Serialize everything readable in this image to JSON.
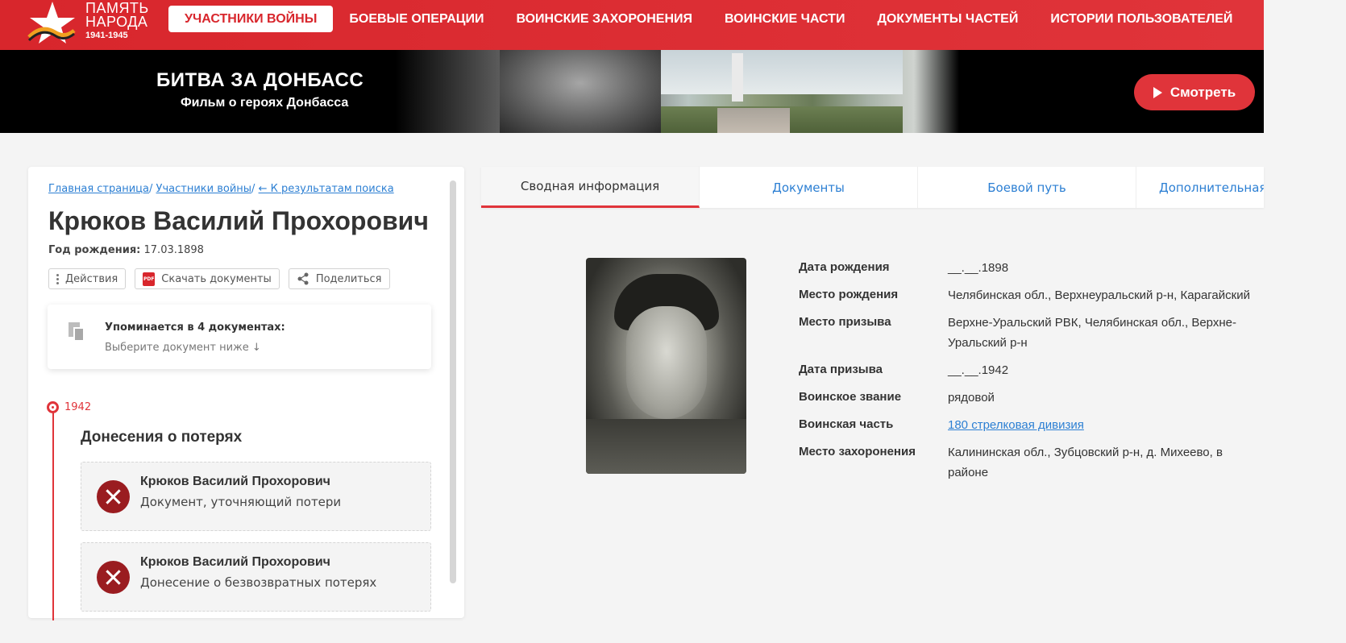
{
  "logo": {
    "line1": "ПАМЯТЬ",
    "line2": "НАРОДА",
    "years": "1941-1945"
  },
  "nav": [
    {
      "label": "УЧАСТНИКИ ВОЙНЫ",
      "active": true
    },
    {
      "label": "БОЕВЫЕ ОПЕРАЦИИ"
    },
    {
      "label": "ВОИНСКИЕ ЗАХОРОНЕНИЯ"
    },
    {
      "label": "ВОИНСКИЕ ЧАСТИ"
    },
    {
      "label": "ДОКУМЕНТЫ ЧАСТЕЙ"
    },
    {
      "label": "ИСТОРИИ ПОЛЬЗОВАТЕЛЕЙ"
    }
  ],
  "banner": {
    "title": "БИТВА ЗА ДОНБАСС",
    "subtitle": "Фильм о героях Донбасса",
    "watch_label": "Смотреть"
  },
  "breadcrumb": {
    "home": "Главная страница",
    "participants": "Участники войны",
    "back": "← К результатам поиска",
    "separator": "/"
  },
  "person": {
    "name": "Крюков Василий Прохорович",
    "birth_label": "Год рождения:",
    "birth_value": "17.03.1898"
  },
  "actions": {
    "actions_label": "Действия",
    "download_label": "Скачать документы",
    "share_label": "Поделиться",
    "pdf_text": "PDF"
  },
  "mentions": {
    "title": "Упоминается в 4 документах:",
    "hint": "Выберите документ ниже ↓"
  },
  "timeline": {
    "year": "1942",
    "section_title": "Донесения о потерях",
    "documents": [
      {
        "name": "Крюков Василий Прохорович",
        "type": "Документ, уточняющий потери"
      },
      {
        "name": "Крюков Василий Прохорович",
        "type": "Донесение о безвозвратных потерях"
      }
    ]
  },
  "tabs": [
    {
      "label": "Сводная информация",
      "active": true
    },
    {
      "label": "Документы"
    },
    {
      "label": "Боевой путь"
    },
    {
      "label": "Дополнительная и"
    }
  ],
  "info": [
    {
      "label": "Дата рождения",
      "value": "__.__.1898"
    },
    {
      "label": "Место рождения",
      "value": "Челябинская обл., Верхнеуральский р-н, Карагайский"
    },
    {
      "label": "Место призыва",
      "value": "Верхне-Уральский РВК, Челябинская обл., Верхне-Уральский р-н"
    },
    {
      "label": "Дата призыва",
      "value": "__.__.1942"
    },
    {
      "label": "Воинское звание",
      "value": "рядовой"
    },
    {
      "label": "Воинская часть",
      "value": "180 стрелковая дивизия",
      "link": true
    },
    {
      "label": "Место захоронения",
      "value": "Калининская обл., Зубцовский р-н, д. Михеево, в районе"
    }
  ],
  "colors": {
    "brand_red": "#e0343a",
    "link_blue": "#2c7fd3",
    "dark_red": "#9a1c20"
  }
}
